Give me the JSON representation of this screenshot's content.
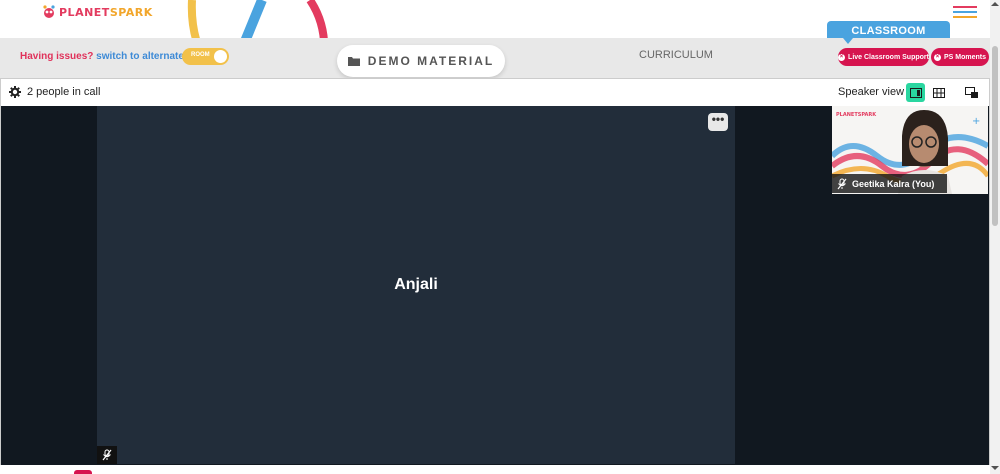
{
  "header": {
    "logo_text_a": "PLANET",
    "logo_text_b": "SPARK"
  },
  "toolbar": {
    "issue_text": "Having issues?",
    "alternate_text": "switch to alternate room",
    "room_toggle_label": "ROOM",
    "demo_material_label": "DEMO MATERIAL",
    "curriculum_label": "CURRICULUM",
    "classroom_tab_label": "CLASSROOM",
    "live_support_label": "Live Classroom Support",
    "ps_moments_label": "PS Moments"
  },
  "call": {
    "people_count_text": "2 people in call",
    "speaker_view_label": "Speaker view",
    "main_participant_name": "Anjali",
    "self_participant_name": "Geetika Kalra (You)",
    "self_tile_logo_text": "PLANETSPARK"
  },
  "colors": {
    "brand_pink": "#e33b5f",
    "brand_orange": "#f2a62b",
    "accent_blue": "#4aa3df",
    "pill_red": "#d6144f",
    "active_view": "#2ad6a0"
  }
}
